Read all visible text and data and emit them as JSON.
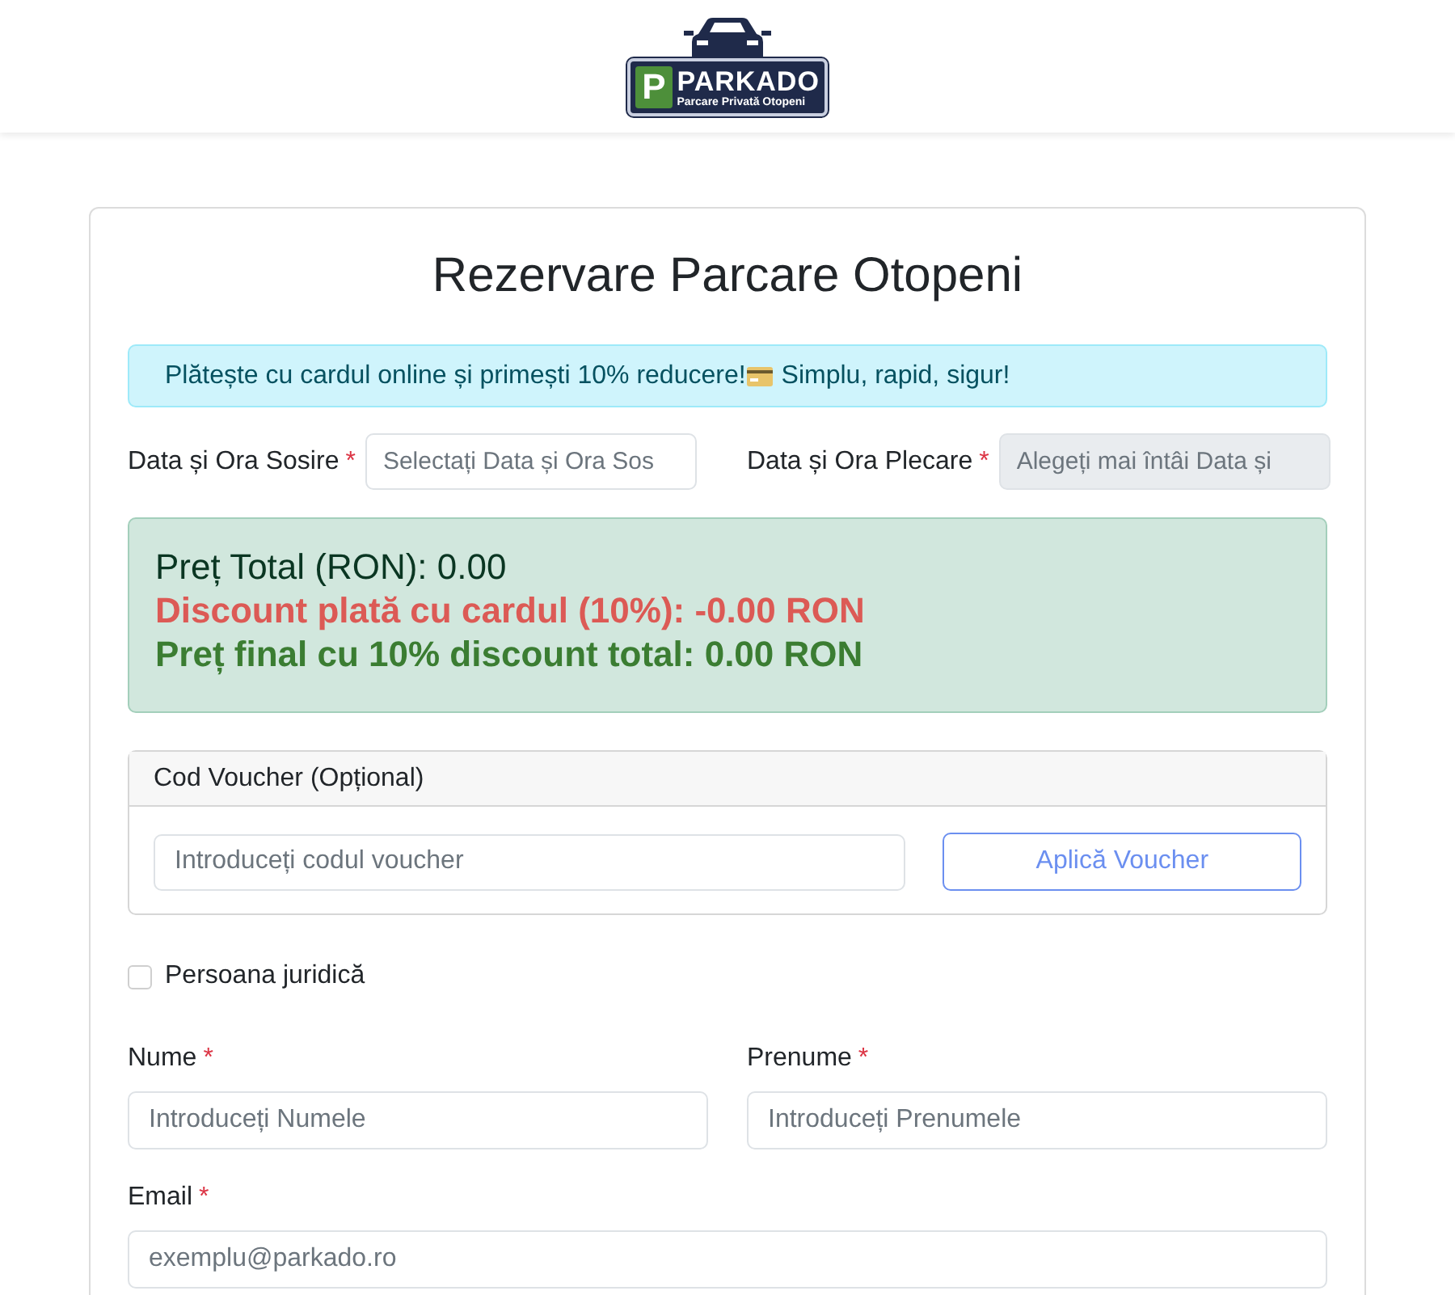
{
  "logo": {
    "name": "PARKADO",
    "letter": "P",
    "tagline": "Parcare Privată Otopeni"
  },
  "title": "Rezervare Parcare Otopeni",
  "alert": {
    "before": "Plătește cu cardul online și primești 10% reducere!",
    "after": "Simplu, rapid, sigur!"
  },
  "dates": [
    {
      "label": "Data și Ora Sosire",
      "required_mark": "*",
      "placeholder": "Selectați Data și Ora Sos",
      "disabled": false
    },
    {
      "label": "Data și Ora Plecare",
      "required_mark": "*",
      "placeholder": "Alegeți mai întâi Data și",
      "disabled": true
    }
  ],
  "price": {
    "total": "Preț Total (RON): 0.00",
    "discount": "Discount plată cu cardul (10%): -0.00 RON",
    "final": "Preț final cu 10% discount total: 0.00 RON"
  },
  "voucher": {
    "header": "Cod Voucher (Opțional)",
    "placeholder": "Introduceți codul voucher",
    "button": "Aplică Voucher"
  },
  "company": {
    "label": "Persoana juridică",
    "checked": false
  },
  "field_rows": [
    [
      {
        "label": "Nume",
        "required_mark": "*",
        "placeholder": "Introduceți Numele"
      },
      {
        "label": "Prenume",
        "required_mark": "*",
        "placeholder": "Introduceți Prenumele"
      }
    ],
    [
      {
        "label": "Email",
        "required_mark": "*",
        "placeholder": "exemplu@parkado.ro"
      }
    ]
  ]
}
